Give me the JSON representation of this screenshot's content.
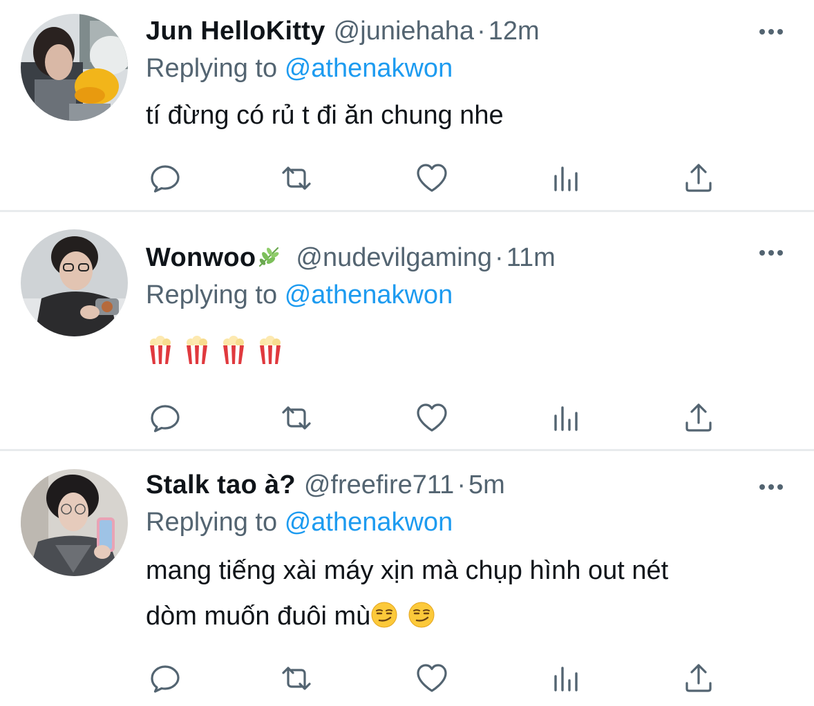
{
  "tweets": [
    {
      "display_name": "Jun HelloKitty",
      "handle": "@juniehaha",
      "time": "12m",
      "replying_prefix": "Replying to",
      "replying_to": "@athenakwon",
      "text_lines": [
        "tí đừng có rủ t đi ăn chung nhe"
      ]
    },
    {
      "display_name": "Wonwoo",
      "handle": "@nudevilgaming",
      "time": "11m",
      "replying_prefix": "Replying to",
      "replying_to": "@athenakwon",
      "emojis": [
        "popcorn-icon",
        "popcorn-icon",
        "popcorn-icon",
        "popcorn-icon"
      ]
    },
    {
      "display_name": "Stalk tao à?",
      "handle": "@freefire711",
      "time": "5m",
      "replying_prefix": "Replying to",
      "replying_to": "@athenakwon",
      "text_lines": [
        "mang tiếng xài máy xịn mà chụp hình out nét",
        "dòm muốn đuôi mù"
      ],
      "trailing_emojis": [
        "smirk-icon",
        "smirk-icon"
      ]
    }
  ],
  "colors": {
    "text": "#0f1419",
    "secondary": "#536471",
    "link": "#1d9bf0",
    "divider": "#e8ebed",
    "action_icon": "#536471"
  },
  "action_icons": [
    "reply-icon",
    "retweet-icon",
    "like-icon",
    "views-icon",
    "share-icon"
  ],
  "separator": "·"
}
